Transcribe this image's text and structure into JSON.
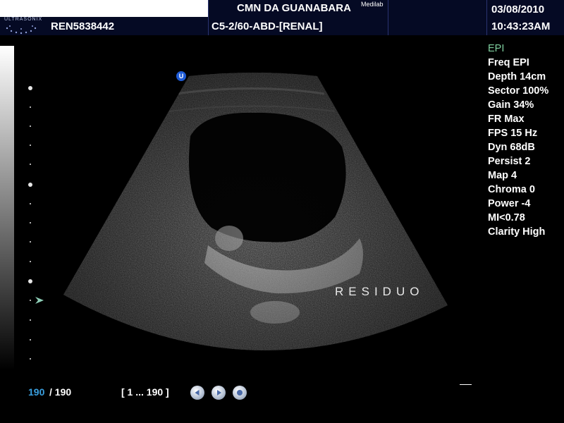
{
  "header": {
    "logo_text": "ULTRASONIX",
    "patient_id": "REN5838442",
    "clinic": "CMN DA GUANABARA",
    "clinic_sup": "Medilab",
    "probe_preset": "C5-2/60-ABD-[RENAL]",
    "date": "03/08/2010",
    "time": "10:43:23AM"
  },
  "image": {
    "orientation_marker": "U",
    "annotation": "RESIDUO"
  },
  "params": [
    "EPI",
    "Freq EPI",
    "Depth 14cm",
    "Sector 100%",
    "Gain 34%",
    "FR Max",
    "FPS 15 Hz",
    "Dyn 68dB",
    "Persist 2",
    "Map 4",
    "Chroma 0",
    "Power -4",
    "MI<0.78",
    "Clarity High"
  ],
  "cine": {
    "current_frame": "190",
    "separator_total": "/ 190",
    "range": "[ 1 ... 190 ]"
  },
  "icons": {
    "prev": "step-back-icon",
    "play": "play-icon",
    "stop": "stop-icon"
  },
  "colors": {
    "header_bg": "#050a24",
    "frame_accent": "#3aa0e0",
    "mode_text": "#7fcf9f",
    "marker": "#1e5bd6"
  }
}
